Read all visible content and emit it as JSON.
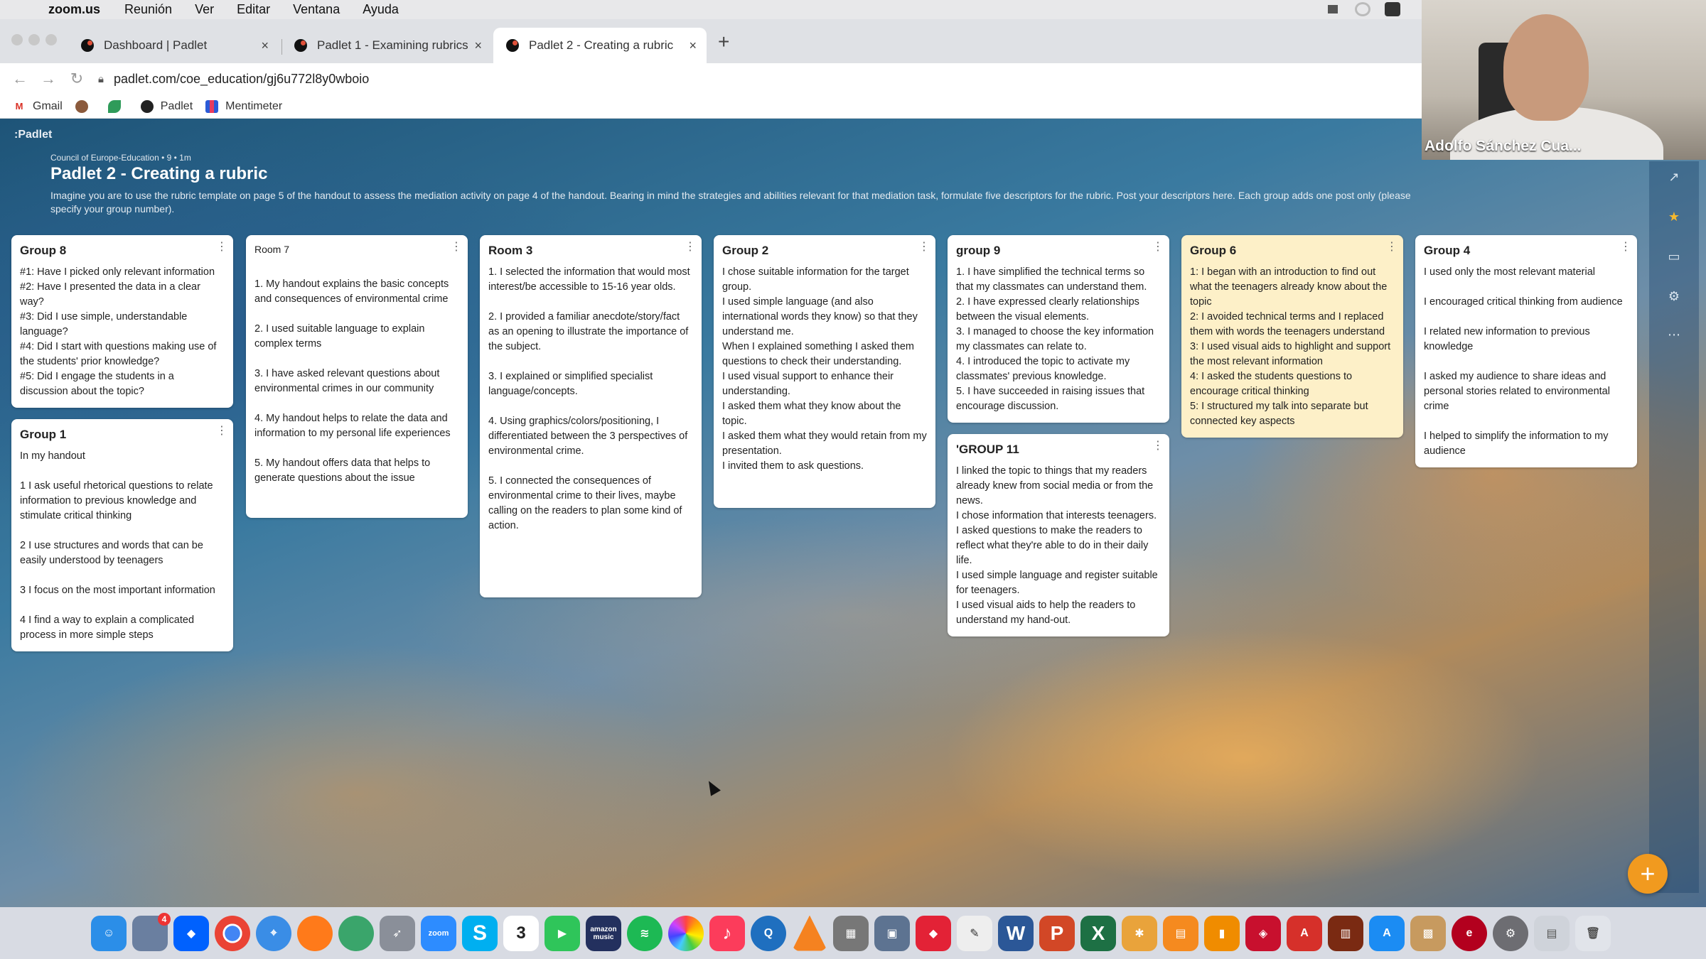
{
  "menubar": {
    "app_name": "zoom.us",
    "items": [
      "Reunión",
      "Ver",
      "Editar",
      "Ventana",
      "Ayuda"
    ]
  },
  "browser": {
    "tabs": [
      {
        "title": "Dashboard | Padlet",
        "active": false
      },
      {
        "title": "Padlet 1 - Examining rubrics",
        "active": false
      },
      {
        "title": "Padlet 2 - Creating a rubric",
        "active": true
      }
    ],
    "url": "padlet.com/coe_education/gj6u772l8y0wboio",
    "bookmarks": [
      "Gmail",
      "",
      "",
      "Padlet",
      "Mentimeter"
    ]
  },
  "padlet": {
    "logo": ":Padlet",
    "meta": "Council of Europe-Education • 9 • 1m",
    "title": "Padlet 2 - Creating a rubric",
    "description": "Imagine you are to use the rubric template on page 5 of the handout to assess the mediation activity on page 4 of the handout. Bearing in mind the strategies and abilities relevant for that mediation task, formulate five descriptors for the rubric. Post your descriptors here. Each group adds one post only (please specify your group number).",
    "columns": [
      [
        {
          "title": "Group 8",
          "body": "#1: Have I picked only relevant information\n#2: Have I presented the data in a clear way?\n#3: Did I use simple, understandable language?\n#4: Did I start with questions making use of the students' prior knowledge?\n#5: Did I engage the students in a discussion about the topic?"
        },
        {
          "title": "Group 1",
          "body": "In my handout\n\n1 I ask useful rhetorical questions to relate information to previous knowledge and stimulate critical thinking\n\n2 I use structures and words that can be easily understood by teenagers\n\n3 I focus on the most important information\n\n4 I find a way to explain a complicated process in more simple steps"
        }
      ],
      [
        {
          "title": "Room 7",
          "body": "\n1. My handout explains the basic concepts and consequences of environmental crime\n\n2. I used suitable language to explain complex terms\n\n3. I have asked relevant questions about environmental crimes in our community\n\n4. My handout helps to relate the data and information to my personal life experiences\n\n5. My handout offers data that helps to generate questions about the issue"
        }
      ],
      [
        {
          "title": "Room 3",
          "body": "1. I selected the information that would most interest/be accessible to 15-16 year olds.\n\n2. I provided a familiar anecdote/story/fact as an opening to illustrate the importance of the subject.\n\n3. I explained or simplified specialist language/concepts.\n\n4. Using graphics/colors/positioning, I differentiated between the 3 perspectives of environmental crime.\n\n5. I connected the consequences of environmental crime to their lives, maybe calling on the readers to plan some kind of action.\n\n"
        }
      ],
      [
        {
          "title": "Group 2",
          "body": "I chose suitable information for the target group.\nI used simple language (and also international words they know) so that they understand me.\nWhen I explained something I asked them questions to check their understanding.\nI used visual support to enhance their understanding.\nI asked them what they know about the topic.\nI asked them what they would retain from my presentation.\nI invited them to ask questions."
        }
      ],
      [
        {
          "title": "group 9",
          "body": "1. I have simplified the technical terms so that my classmates can understand them.\n2. I have expressed clearly relationships between the visual elements.\n3. I managed to choose the key information my classmates can relate to.\n4. I introduced the topic to activate my classmates' previous knowledge.\n5. I have succeeded in raising issues that encourage discussion."
        },
        {
          "title": "'GROUP 11",
          "body": "I linked the topic to things that my readers already knew from social media or from the news.\nI chose information that interests teenagers.\nI asked questions to make the readers to reflect what they're able to do in their daily life.\nI used simple language and register suitable for teenagers.\nI used visual aids to help the readers to understand my hand-out."
        }
      ],
      [
        {
          "title": "Group 6",
          "body": "1: I began with an introduction to find out what the teenagers already know about the topic\n2: I avoided technical terms and I replaced them with words the teenagers understand\n3: I used visual aids to highlight and support the most relevant information\n4: I asked the students questions to encourage critical thinking\n5: I structured my talk into separate but connected key aspects"
        }
      ],
      [
        {
          "title": "Group 4",
          "body": " I used only the most relevant material\n\nI encouraged critical thinking from audience\n\nI related new information to previous knowledge\n\nI asked my audience to share ideas and personal stories related to environmental crime\n\nI helped to simplify the information to my audience"
        }
      ]
    ]
  },
  "video": {
    "participant_name": "Adolfo Sánchez Cua..."
  },
  "dock": {
    "zoom_label": "zoom",
    "music_label": "amazon music",
    "calendar_day": "3",
    "mail_badge": "4"
  },
  "colors": {
    "fab": "#f19a1f",
    "yellow_card": "#fdf0c8"
  }
}
